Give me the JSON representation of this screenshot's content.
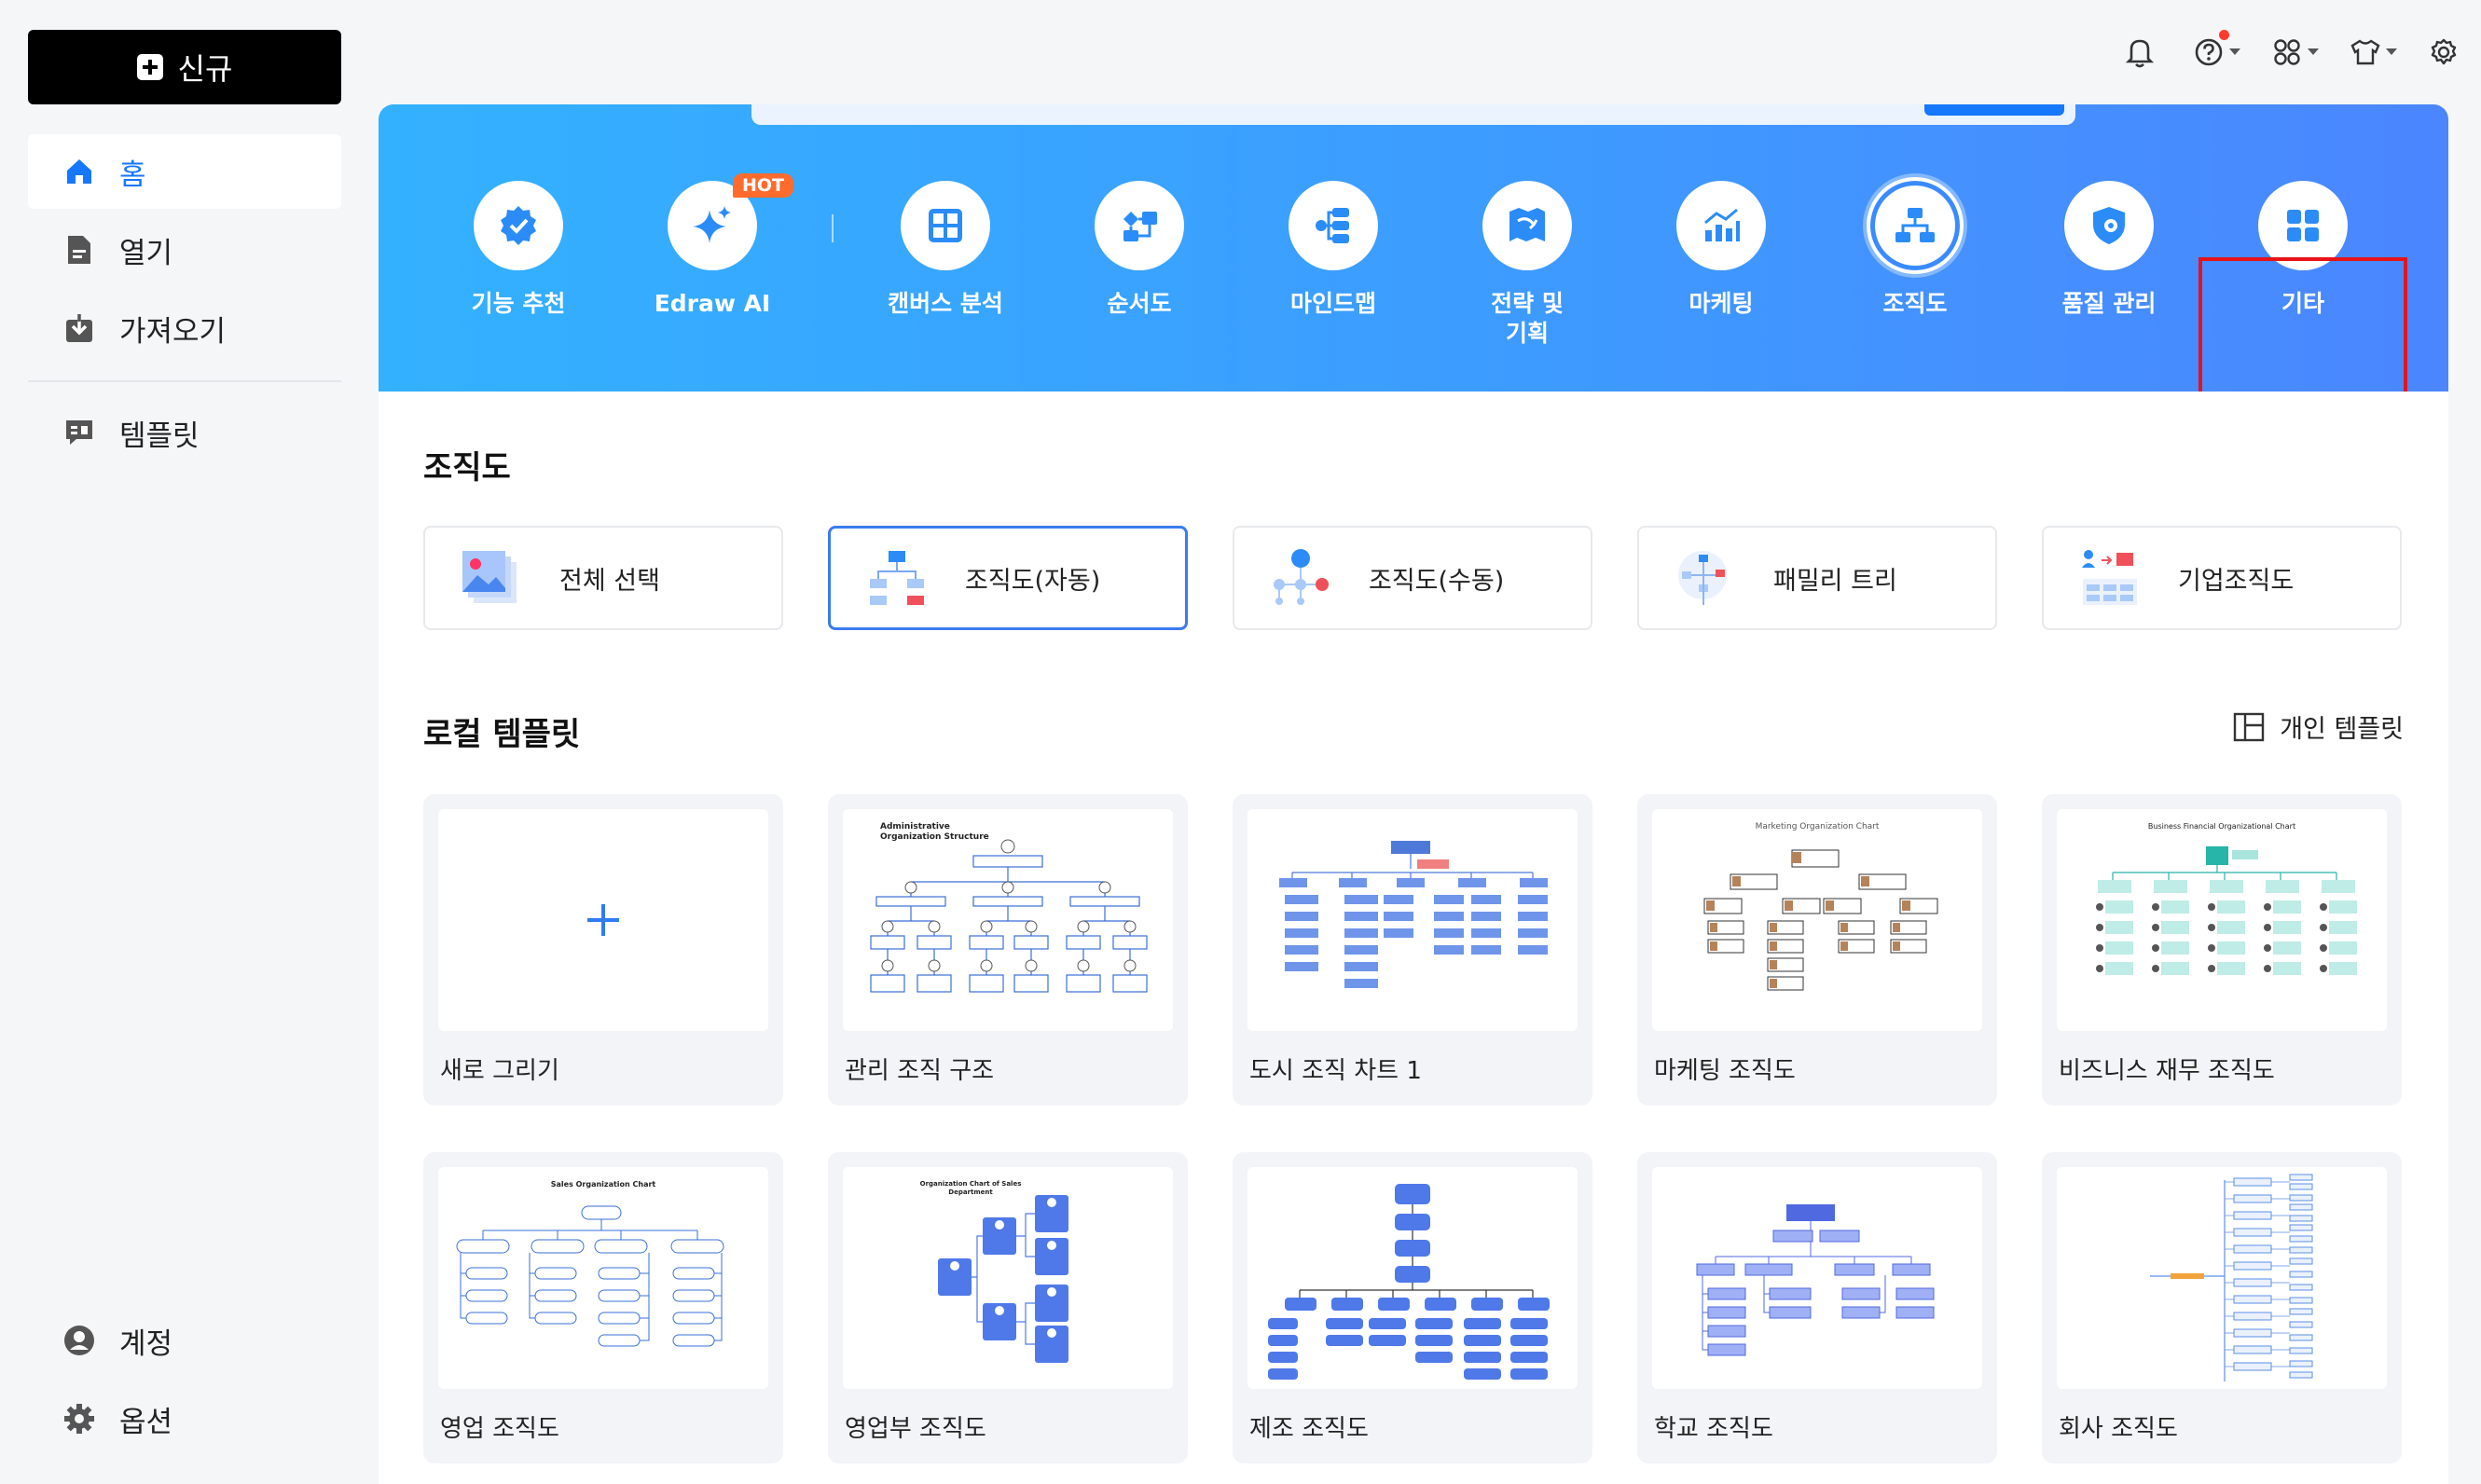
{
  "sidebar": {
    "new_button": "신규",
    "items": [
      {
        "label": "홈",
        "icon": "home-icon"
      },
      {
        "label": "열기",
        "icon": "document-icon"
      },
      {
        "label": "가져오기",
        "icon": "import-icon"
      },
      {
        "label": "템플릿",
        "icon": "template-icon"
      }
    ],
    "bottom_items": [
      {
        "label": "계정",
        "icon": "user-icon"
      },
      {
        "label": "옵션",
        "icon": "gear-icon"
      }
    ]
  },
  "toolbar": {
    "icons": [
      "bell-icon",
      "help-icon",
      "apps-icon",
      "shirt-icon",
      "settings-icon"
    ]
  },
  "banner": {
    "categories": [
      {
        "label": "기능 추천",
        "icon": "feature-badge-icon"
      },
      {
        "label": "Edraw AI",
        "icon": "sparkle-icon",
        "badge": "HOT"
      },
      {
        "label": "캔버스 분석",
        "icon": "canvas-grid-icon"
      },
      {
        "label": "순서도",
        "icon": "flowchart-icon"
      },
      {
        "label": "마인드맵",
        "icon": "mindmap-icon"
      },
      {
        "label": "전략 및\n기획",
        "icon": "strategy-map-icon"
      },
      {
        "label": "마케팅",
        "icon": "chart-icon"
      },
      {
        "label": "조직도",
        "icon": "org-chart-icon"
      },
      {
        "label": "품질 관리",
        "icon": "quality-shield-icon"
      },
      {
        "label": "기타",
        "icon": "more-grid-icon"
      }
    ],
    "selected": "조직도"
  },
  "main": {
    "section_title": "조직도",
    "filters": [
      "전체 선택",
      "조직도(자동)",
      "조직도(수동)",
      "패밀리 트리",
      "기업조직도"
    ],
    "active_filter": "조직도(자동)",
    "local_title": "로컬 템플릿",
    "personal_templates": "개인 템플릿",
    "templates": [
      {
        "name": "새로 그리기"
      },
      {
        "name": "관리 조직 구조",
        "mini_title": "Administrative\nOrganization Structure"
      },
      {
        "name": "도시 조직 차트 1"
      },
      {
        "name": "마케팅 조직도",
        "mini_title": "Marketing Organization Chart"
      },
      {
        "name": "비즈니스 재무 조직도",
        "mini_title": "Business Financial Organizational Chart"
      },
      {
        "name": "영업 조직도",
        "mini_title": "Sales Organization Chart"
      },
      {
        "name": "영업부 조직도",
        "mini_title": "Organization Chart of Sales\nDepartment"
      },
      {
        "name": "제조 조직도"
      },
      {
        "name": "학교 조직도"
      },
      {
        "name": "회사 조직도"
      }
    ]
  },
  "colors": {
    "accent": "#1677ff",
    "banner_start": "#33b1ff",
    "banner_end": "#4b86ff",
    "highlight": "#e8121a",
    "hot": "#ff6b2c"
  }
}
